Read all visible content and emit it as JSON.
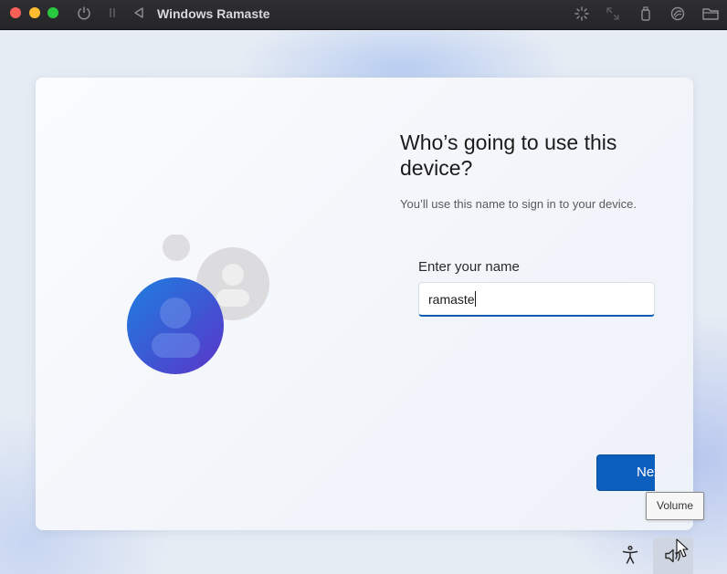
{
  "window": {
    "title": "Windows Ramaste",
    "toolbar_icons": [
      "power-icon",
      "pause-icon",
      "back-icon",
      "brightness-icon",
      "resize-icon",
      "usb-icon",
      "network-icon",
      "folder-icon"
    ]
  },
  "oobe": {
    "heading": "Who’s going to use this device?",
    "subtext": "You’ll use this name to sign in to your device.",
    "name_label": "Enter your name",
    "name_value": "ramaste",
    "next_label": "Next"
  },
  "taskbar": {
    "tooltip": "Volume",
    "icons": [
      "accessibility-icon",
      "volume-icon"
    ]
  },
  "colors": {
    "accent": "#0c5fbd",
    "avatar_primary": "#2f60d8",
    "avatar_secondary": "#dcdcde"
  }
}
